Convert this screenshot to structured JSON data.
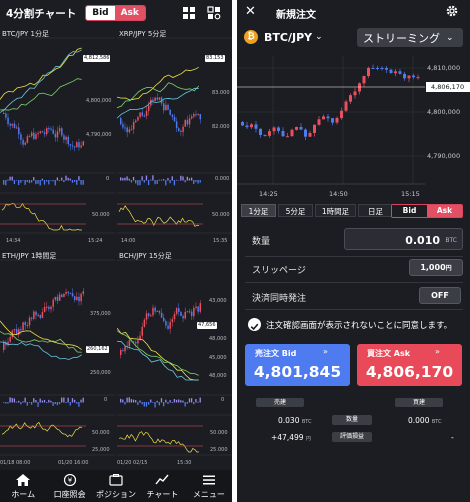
{
  "left": {
    "title": "4分割チャート",
    "toggle": {
      "bid": "Bid",
      "ask": "Ask"
    },
    "icons": [
      "grid-icon",
      "settings-grid-icon"
    ],
    "charts": [
      {
        "title": "BTC/JPY 1分足",
        "price_tag": "4,812,586",
        "ticks": [
          "4,800,000",
          "4,790,000"
        ],
        "osc_ticks": [
          "0",
          "50.000"
        ],
        "xlabels": [
          "14:34",
          "15:24"
        ]
      },
      {
        "title": "XRP/JPY 5分足",
        "price_tag": "83.153",
        "ticks": [
          "83.000",
          "82.000"
        ],
        "osc_ticks": [
          "0.000",
          "50.000"
        ],
        "xlabels": [
          "14:00",
          "15:35"
        ]
      },
      {
        "title": "ETH/JPY 1時間足",
        "price_tag": "260,162",
        "ticks": [
          "375,000",
          "250,000"
        ],
        "osc_ticks": [
          "0",
          "50.000",
          "25,000"
        ],
        "xlabels": [
          "01/18 08:00",
          "01/20 16:00"
        ]
      },
      {
        "title": "BCH/JPY 15分足",
        "price_tag": "47,656",
        "ticks": [
          "43,000",
          "48,000",
          "45,000",
          "48,000"
        ],
        "osc_ticks": [
          "0",
          "50.000",
          "25.000"
        ],
        "xlabels": [
          "01/20 02/15",
          "15:30"
        ]
      }
    ],
    "nav": [
      {
        "label": "ホーム",
        "icon": "home-icon"
      },
      {
        "label": "口座照会",
        "icon": "account-icon"
      },
      {
        "label": "ポジション",
        "icon": "position-icon"
      },
      {
        "label": "チャート",
        "icon": "chart-icon"
      },
      {
        "label": "メニュー",
        "icon": "menu-icon"
      }
    ]
  },
  "right": {
    "title": "新規注文",
    "pair": "BTC/JPY",
    "coin_symbol": "₿",
    "mode": "ストリーミング",
    "chart_ticks": [
      "4,810,000",
      "4,800,000",
      "4,790,000"
    ],
    "price_tag": "4,806,170",
    "chart_xlabels": [
      "14:25",
      "14:50",
      "15:15"
    ],
    "timeframes": [
      "1分足",
      "5分足",
      "1時間足",
      "日足"
    ],
    "toggle": {
      "bid": "Bid",
      "ask": "Ask"
    },
    "qty_label": "数量",
    "qty_value": "0.010",
    "qty_unit": "BTC",
    "slippage_label": "スリッページ",
    "slippage_value": "1,000",
    "slippage_unit": "円",
    "settle_label": "決済同時発注",
    "settle_value": "OFF",
    "consent_text": "注文確認画面が表示されないことに同意します。",
    "sell": {
      "label": "売注文 Bid",
      "price": "4,801,845"
    },
    "buy": {
      "label": "買注文 Ask",
      "price": "4,806,170"
    },
    "positions": {
      "sell_header": "売建",
      "buy_header": "買建",
      "sell_qty": "0.030",
      "sell_qty_unit": "BTC",
      "qty_label": "数量",
      "buy_qty": "0.000",
      "buy_qty_unit": "BTC",
      "sell_pl": "+47,499",
      "sell_pl_unit": "円",
      "pl_label": "評価損益",
      "buy_pl": "-"
    }
  },
  "colors": {
    "bg": "#1b1d22",
    "bid": "#4f7bf0",
    "ask": "#e84a5a",
    "accent": "#e25064"
  }
}
